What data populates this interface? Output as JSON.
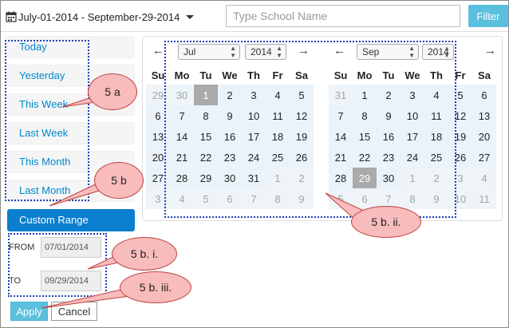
{
  "date_range": {
    "label": "July-01-2014 - September-29-2014"
  },
  "search": {
    "placeholder": "Type School Name",
    "value": ""
  },
  "filter_label": "Filter",
  "ranges": [
    "Today",
    "Yesterday",
    "This Week",
    "Last Week",
    "This Month",
    "Last Month",
    "Custom Range"
  ],
  "active_range": "Custom Range",
  "inputs": {
    "from_label": "FROM",
    "from_value": "07/01/2014",
    "to_label": "TO",
    "to_value": "09/29/2014"
  },
  "buttons": {
    "apply": "Apply",
    "cancel": "Cancel"
  },
  "weekdays": [
    "Mo",
    "Tu",
    "We",
    "Th",
    "Fr",
    "Sa"
  ],
  "sunday": "Su",
  "left_cal": {
    "month": "Jul",
    "year": "2014",
    "rows": [
      [
        "29",
        "30",
        "1",
        "2",
        "3",
        "4",
        "5"
      ],
      [
        "6",
        "7",
        "8",
        "9",
        "10",
        "11",
        "12"
      ],
      [
        "13",
        "14",
        "15",
        "16",
        "17",
        "18",
        "19"
      ],
      [
        "20",
        "21",
        "22",
        "23",
        "24",
        "25",
        "26"
      ],
      [
        "27",
        "28",
        "29",
        "30",
        "31",
        "1",
        "2"
      ],
      [
        "3",
        "4",
        "5",
        "6",
        "7",
        "8",
        "9"
      ]
    ]
  },
  "right_cal": {
    "month": "Sep",
    "year": "2014",
    "rows": [
      [
        "31",
        "1",
        "2",
        "3",
        "4",
        "5",
        "6"
      ],
      [
        "7",
        "8",
        "9",
        "10",
        "11",
        "12",
        "13"
      ],
      [
        "14",
        "15",
        "16",
        "17",
        "18",
        "19",
        "20"
      ],
      [
        "21",
        "22",
        "23",
        "24",
        "25",
        "26",
        "27"
      ],
      [
        "28",
        "29",
        "30",
        "1",
        "2",
        "3",
        "4"
      ],
      [
        "5",
        "6",
        "7",
        "8",
        "9",
        "10",
        "11"
      ]
    ]
  },
  "annotations": [
    "5 a",
    "5 b",
    "5 b. i.",
    "5 b. ii.",
    "5 b. iii."
  ],
  "colors": {
    "accent": "#0a7fcf",
    "filter": "#5bc0de",
    "callout": "#f8bcbc",
    "dotted_box": "#1c3fb8"
  }
}
